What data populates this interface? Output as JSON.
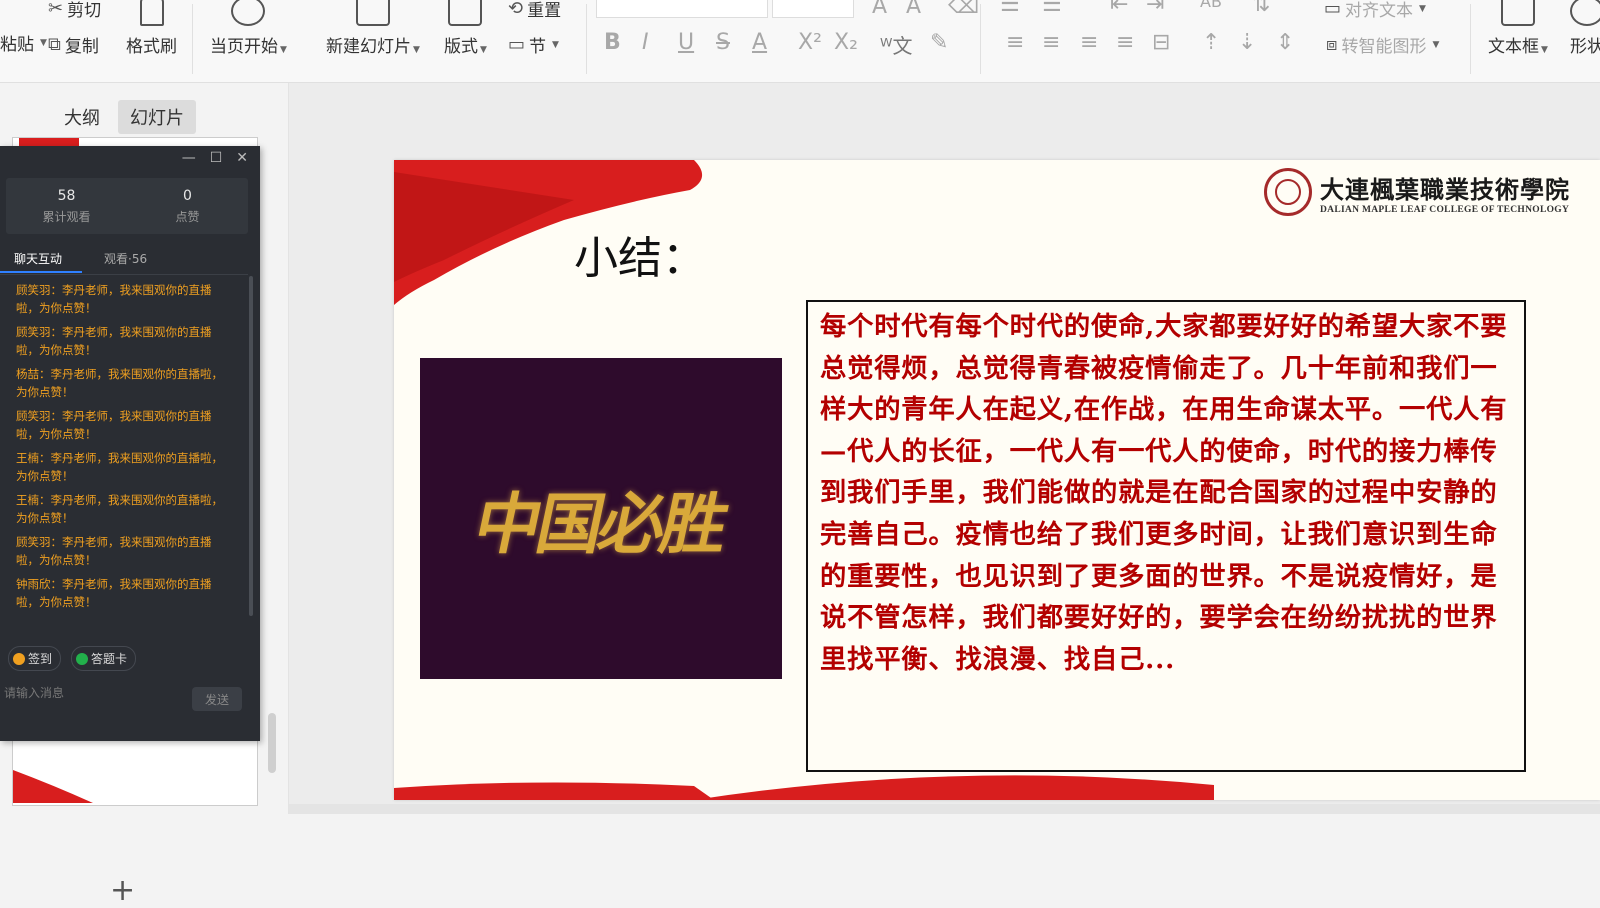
{
  "toolbar": {
    "paste": "粘贴",
    "cut": "剪切",
    "copy": "复制",
    "format_painter": "格式刷",
    "from_current": "当页开始",
    "new_slide": "新建幻灯片",
    "layout": "版式",
    "section": "节",
    "reset": "重置",
    "align_text": "对齐文本",
    "convert_smartart": "转智能图形",
    "text_box": "文本框",
    "shape": "形状"
  },
  "sidebar": {
    "tab_outline": "大纲",
    "tab_slides": "幻灯片"
  },
  "slide": {
    "title": "小结：",
    "logo_cn": "大連楓葉職業技術學院",
    "logo_en": "DALIAN MAPLE LEAF COLLEGE OF TECHNOLOGY",
    "image_caption": "中国必胜",
    "body": "每个时代有每个时代的使命,大家都要好好的希望大家不要总觉得烦，总觉得青春被疫情偷走了。几十年前和我们一样大的青年人在起义,在作战，在用生命谋太平。一代人有—代人的长征，一代人有一代人的使命，时代的接力棒传到我们手里，我们能做的就是在配合国家的过程中安静的完善自己。疫情也给了我们更多时间，让我们意识到生命的重要性，也见识到了更多面的世界。不是说疫情好，是说不管怎样，我们都要好好的，要学会在纷纷扰扰的世界里找平衡、找浪漫、找自己..."
  },
  "live": {
    "views_count": "58",
    "views_label": "累计观看",
    "likes_count": "0",
    "likes_label": "点赞",
    "tab_chat": "聊天互动",
    "tab_watch": "观看·56",
    "messages": [
      "顾笑羽：李丹老师，我来围观你的直播啦，为你点赞！",
      "顾笑羽：李丹老师，我来围观你的直播啦，为你点赞！",
      "杨喆：李丹老师，我来围观你的直播啦，为你点赞！",
      "顾笑羽：李丹老师，我来围观你的直播啦，为你点赞！",
      "王楠：李丹老师，我来围观你的直播啦，为你点赞！",
      "王楠：李丹老师，我来围观你的直播啦，为你点赞！",
      "顾笑羽：李丹老师，我来围观你的直播啦，为你点赞！",
      "钟雨欣：李丹老师，我来围观你的直播啦，为你点赞！"
    ],
    "checkin": "签到",
    "answer_card": "答题卡",
    "input_placeholder": "请输入消息",
    "send": "发送"
  },
  "colors": {
    "slide_text": "#b30000",
    "accent_red": "#d81e1e",
    "live_panel_bg": "#2a2d33",
    "chat_text": "#f0a020",
    "tab_underline": "#2f80ff"
  }
}
